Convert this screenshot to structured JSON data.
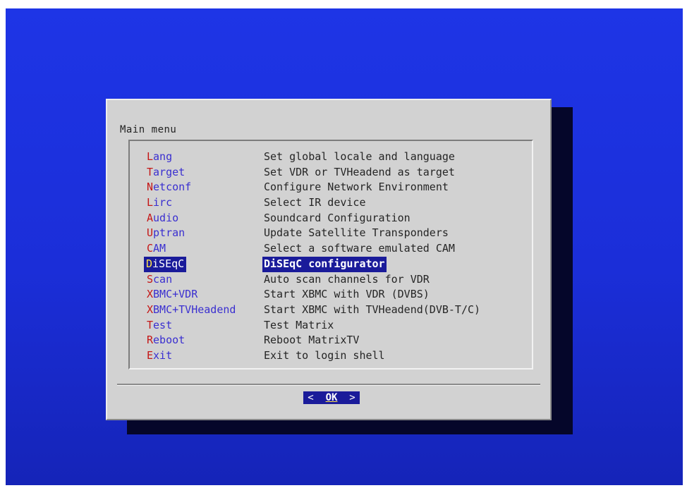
{
  "dialog": {
    "title": "Main menu",
    "items": [
      {
        "hotkey": "L",
        "tag_rest": "ang",
        "description": "Set global locale and language"
      },
      {
        "hotkey": "T",
        "tag_rest": "arget",
        "description": "Set VDR or TVHeadend as target"
      },
      {
        "hotkey": "N",
        "tag_rest": "etconf",
        "description": "Configure Network Environment"
      },
      {
        "hotkey": "L",
        "tag_rest": "irc",
        "description": "Select IR device"
      },
      {
        "hotkey": "A",
        "tag_rest": "udio",
        "description": "Soundcard Configuration"
      },
      {
        "hotkey": "U",
        "tag_rest": "ptran",
        "description": "Update Satellite Transponders"
      },
      {
        "hotkey": "C",
        "tag_rest": "AM",
        "description": "Select a software emulated CAM"
      },
      {
        "hotkey": "D",
        "tag_rest": "iSEqC",
        "description": "DiSEqC configurator",
        "selected": true
      },
      {
        "hotkey": "S",
        "tag_rest": "can",
        "description": "Auto scan channels for VDR"
      },
      {
        "hotkey": "X",
        "tag_rest": "BMC+VDR",
        "description": "Start XBMC with VDR (DVBS)"
      },
      {
        "hotkey": "X",
        "tag_rest": "BMC+TVHeadend",
        "description": "Start XBMC with TVHeadend(DVB-T/C)"
      },
      {
        "hotkey": "T",
        "tag_rest": "est",
        "description": "Test Matrix"
      },
      {
        "hotkey": "R",
        "tag_rest": "eboot",
        "description": "Reboot MatrixTV"
      },
      {
        "hotkey": "E",
        "tag_rest": "xit",
        "description": "Exit to login shell"
      }
    ],
    "button": {
      "left_bracket": "<",
      "label": "OK",
      "right_bracket": ">"
    }
  },
  "colors": {
    "background_blue": "#1e35e6",
    "dialog_gray": "#d2d2d2",
    "selection_blue": "#1a1b9a",
    "hotkey_red": "#c41616",
    "tag_blue": "#3a2fd0",
    "selected_hotkey_yellow": "#ffe44a"
  }
}
